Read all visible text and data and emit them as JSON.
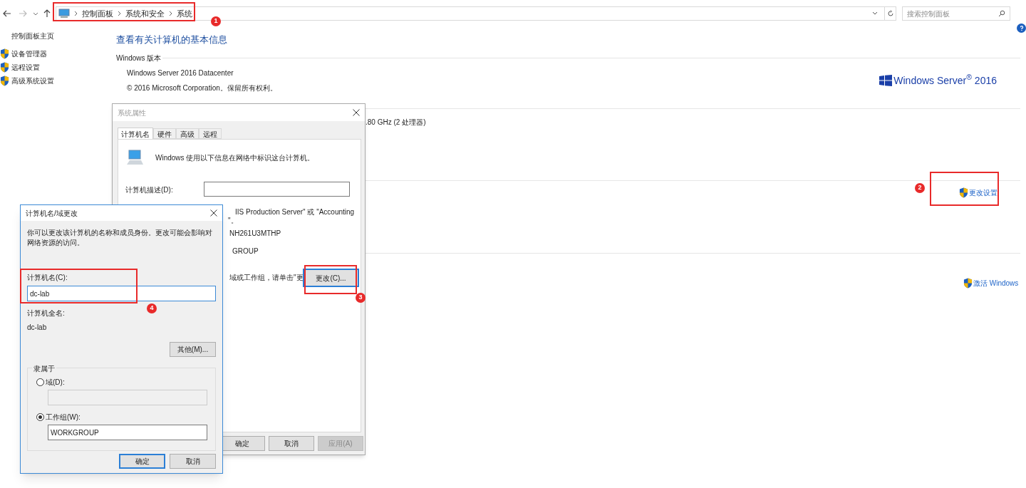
{
  "nav": {
    "breadcrumbs": [
      "控制面板",
      "系统和安全",
      "系统"
    ],
    "search_placeholder": "搜索控制面板"
  },
  "sidebar": {
    "home": "控制面板主页",
    "items": [
      "设备管理器",
      "远程设置",
      "高级系统设置"
    ]
  },
  "main": {
    "title": "查看有关计算机的基本信息",
    "edition_heading": "Windows 版本",
    "edition_lines": [
      "Windows Server 2016 Datacenter",
      "© 2016 Microsoft Corporation。保留所有权利。"
    ],
    "logo_text": "Windows Server$^{®}$ 2016",
    "processor_fragment": ".80 GHz (2 处理器)",
    "change_settings": "更改设置",
    "activate": "激活 Windows"
  },
  "system_properties": {
    "title": "系统属性",
    "tabs": [
      {
        "label": "计算机名",
        "selected": true
      },
      {
        "label": "硬件",
        "selected": false
      },
      {
        "label": "高级",
        "selected": false
      },
      {
        "label": "远程",
        "selected": false
      }
    ],
    "intro": "Windows 使用以下信息在网络中标识这台计算机。",
    "description_label": "计算机描述(D):",
    "fragments": [
      "IIS Production Server\" 或 \"Accounting",
      "\"。",
      "NH261U3MTHP",
      "GROUP",
      "域或工作组，请单击\"更"
    ],
    "change_button": "更改(C)...",
    "buttons": [
      {
        "label": "确定",
        "disabled": false
      },
      {
        "label": "取消",
        "disabled": false
      },
      {
        "label": "应用(A)",
        "disabled": true
      }
    ]
  },
  "rename_dialog": {
    "title": "计算机名/域更改",
    "intro": "你可以更改该计算机的名称和成员身份。更改可能会影响对网络资源的访问。",
    "name_label": "计算机名(C):",
    "name_value": "dc-lab",
    "full_name_label": "计算机全名:",
    "full_name": "dc-lab",
    "more_button": "其他(M)...",
    "member_of": "隶属于",
    "options": [
      {
        "label": "域(D):",
        "selected": false,
        "value_disabled": true
      },
      {
        "label": "工作组(W):",
        "selected": true,
        "value": "WORKGROUP",
        "value_disabled": false
      }
    ],
    "buttons": [
      {
        "label": "确定",
        "default": true
      },
      {
        "label": "取消",
        "default": false
      }
    ]
  },
  "annotations": [
    {
      "number": "1"
    },
    {
      "number": "2"
    },
    {
      "number": "3"
    },
    {
      "number": "4"
    }
  ]
}
